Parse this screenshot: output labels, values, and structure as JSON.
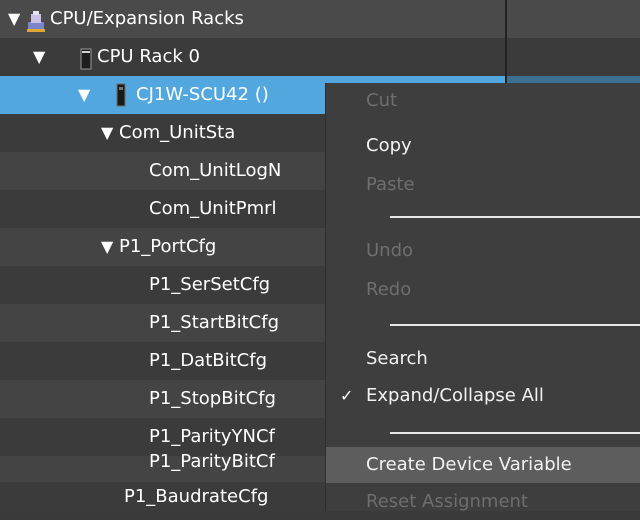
{
  "tree": {
    "rows": [
      {
        "label": "CPU/Expansion Racks",
        "expanded": true,
        "icon": "rack-folder-icon"
      },
      {
        "label": "CPU Rack 0",
        "expanded": true,
        "icon": "cpu-rack-icon"
      },
      {
        "label": "CJ1W-SCU42 ()",
        "expanded": true,
        "selected": true,
        "icon": "unit-module-icon"
      },
      {
        "label": "Com_UnitSta",
        "expanded": true
      },
      {
        "label": "Com_UnitLogN"
      },
      {
        "label": "Com_UnitPmrl"
      },
      {
        "label": "P1_PortCfg",
        "expanded": true
      },
      {
        "label": "P1_SerSetCfg"
      },
      {
        "label": "P1_StartBitCfg"
      },
      {
        "label": "P1_DatBitCfg"
      },
      {
        "label": "P1_StopBitCfg"
      },
      {
        "label": "P1_ParityYNCf"
      },
      {
        "label": "P1_ParityBitCf"
      },
      {
        "label": "P1_BaudrateCfg"
      }
    ],
    "expand_glyph": "▼"
  },
  "context_menu": {
    "items": [
      {
        "label": "Cut",
        "enabled": false
      },
      {
        "label": "Copy",
        "enabled": true
      },
      {
        "label": "Paste",
        "enabled": false
      },
      {
        "label": "Undo",
        "enabled": false
      },
      {
        "label": "Redo",
        "enabled": false
      },
      {
        "label": "Search",
        "enabled": true
      },
      {
        "label": "Expand/Collapse All",
        "enabled": true,
        "checked": true
      },
      {
        "label": "Create Device Variable",
        "enabled": true,
        "highlighted": true
      },
      {
        "label": "Reset Assignment",
        "enabled": false
      }
    ],
    "check_glyph": "✓"
  },
  "colors": {
    "selection": "#52a7df",
    "background": "#3a3a3a",
    "menu_background": "#3e3e3e",
    "menu_hover": "#5d5d5d",
    "disabled_text": "#6e6e6e"
  }
}
